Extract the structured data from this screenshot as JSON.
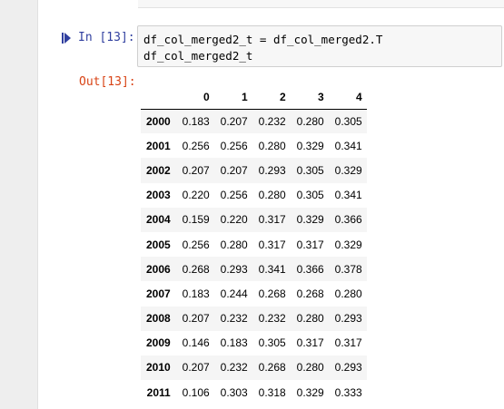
{
  "cell": {
    "in_prompt": "In [13]:",
    "code_lines": [
      "df_col_merged2_t = df_col_merged2.T",
      "df_col_merged2_t"
    ],
    "out_prompt": "Out[13]:"
  },
  "table": {
    "columns": [
      "",
      "0",
      "1",
      "2",
      "3",
      "4"
    ],
    "rows": [
      {
        "index": "2000",
        "values": [
          "0.183",
          "0.207",
          "0.232",
          "0.280",
          "0.305"
        ]
      },
      {
        "index": "2001",
        "values": [
          "0.256",
          "0.256",
          "0.280",
          "0.329",
          "0.341"
        ]
      },
      {
        "index": "2002",
        "values": [
          "0.207",
          "0.207",
          "0.293",
          "0.305",
          "0.329"
        ]
      },
      {
        "index": "2003",
        "values": [
          "0.220",
          "0.256",
          "0.280",
          "0.305",
          "0.341"
        ]
      },
      {
        "index": "2004",
        "values": [
          "0.159",
          "0.220",
          "0.317",
          "0.329",
          "0.366"
        ]
      },
      {
        "index": "2005",
        "values": [
          "0.256",
          "0.280",
          "0.317",
          "0.317",
          "0.329"
        ]
      },
      {
        "index": "2006",
        "values": [
          "0.268",
          "0.293",
          "0.341",
          "0.366",
          "0.378"
        ]
      },
      {
        "index": "2007",
        "values": [
          "0.183",
          "0.244",
          "0.268",
          "0.268",
          "0.280"
        ]
      },
      {
        "index": "2008",
        "values": [
          "0.207",
          "0.232",
          "0.232",
          "0.280",
          "0.293"
        ]
      },
      {
        "index": "2009",
        "values": [
          "0.146",
          "0.183",
          "0.305",
          "0.317",
          "0.317"
        ]
      },
      {
        "index": "2010",
        "values": [
          "0.207",
          "0.232",
          "0.268",
          "0.280",
          "0.293"
        ]
      },
      {
        "index": "2011",
        "values": [
          "0.106",
          "0.303",
          "0.318",
          "0.329",
          "0.333"
        ]
      }
    ]
  },
  "icons": {
    "run": "run-cell-icon"
  },
  "colors": {
    "in_prompt": "#303f9f",
    "out_prompt": "#d84315"
  }
}
